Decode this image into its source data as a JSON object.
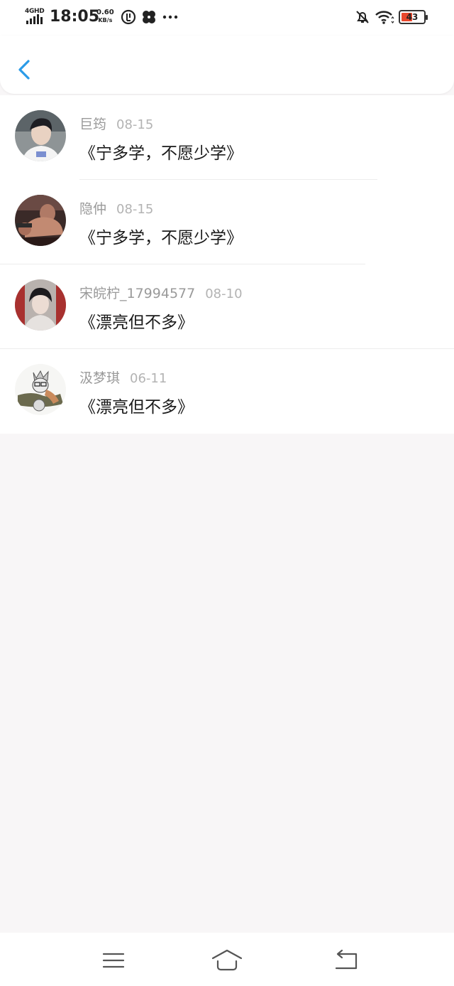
{
  "status_bar": {
    "network": "4GHD",
    "time": "18:05",
    "speed_value": "0.60",
    "speed_unit": "KB/s",
    "battery": "43",
    "icons": [
      "signal-icon",
      "data-saver-icon",
      "fan-icon",
      "more-dots-icon",
      "mute-bell-icon",
      "wifi-icon",
      "battery-icon"
    ]
  },
  "nav": {
    "back_icon": "chevron-left-icon",
    "accent": "#2a9be8"
  },
  "comments": [
    {
      "name": "巨筠",
      "date": "08-15",
      "text": "《宁多学，不愿少学》"
    },
    {
      "name": "隐仲",
      "date": "08-15",
      "text": "《宁多学，不愿少学》"
    },
    {
      "name": "宋皖柠_17994577",
      "date": "08-10",
      "text": "《漂亮但不多》"
    },
    {
      "name": "汲梦琪",
      "date": "06-11",
      "text": "《漂亮但不多》"
    }
  ],
  "bottom_bar": {
    "icons": [
      "menu-icon",
      "home-icon",
      "back-return-icon"
    ]
  }
}
